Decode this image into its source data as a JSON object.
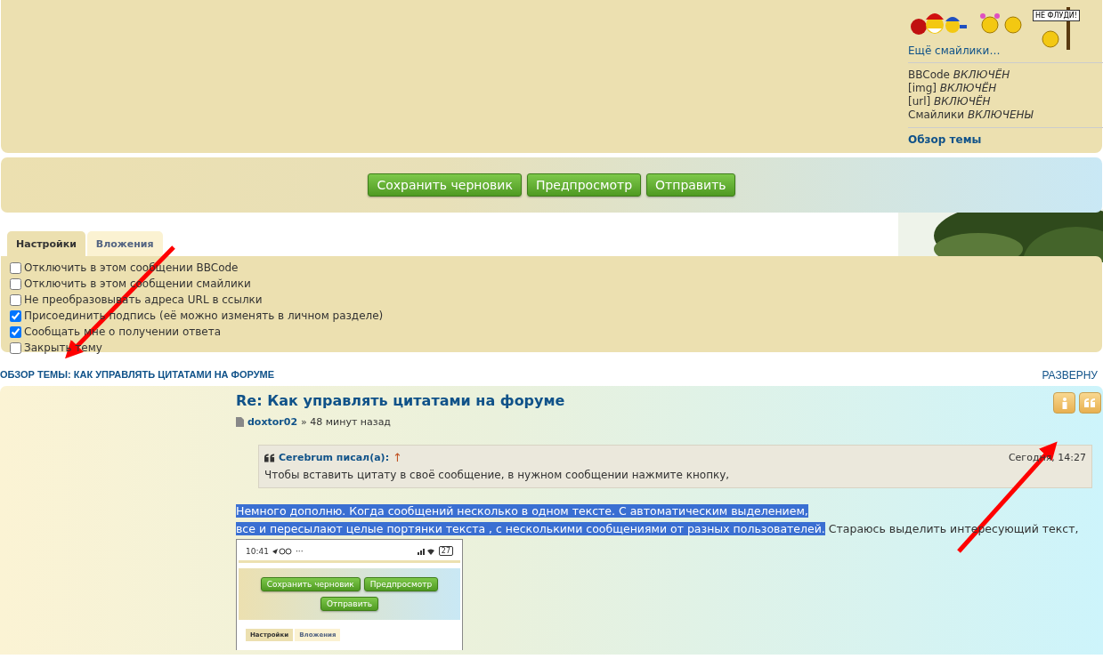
{
  "sidebar": {
    "smileys_sign": "НЕ ФЛУДИ!",
    "more_smileys": "Ещё смайлики…",
    "statuses": [
      "BBCode *ВКЛЮЧЁН*",
      "[img] *ВКЛЮЧЁН*",
      "[url] *ВКЛЮЧЁН*",
      "Смайлики *ВКЛЮЧЕНЫ*"
    ],
    "topic_review_link": "Обзор темы"
  },
  "submit_buttons": [
    "Сохранить черновик",
    "Предпросмотр",
    "Отправить"
  ],
  "tabs": [
    {
      "label": "Настройки",
      "selected": true
    },
    {
      "label": "Вложения",
      "selected": false
    }
  ],
  "options": [
    {
      "label": "Отключить в этом сообщении BBCode",
      "checked": false
    },
    {
      "label": "Отключить в этом сообщении смайлики",
      "checked": false
    },
    {
      "label": "Не преобразовывать адреса URL в ссылки",
      "checked": false
    },
    {
      "label": "Присоединить подпись (её можно изменять в личном разделе)",
      "checked": true
    },
    {
      "label": "Сообщать мне о получении ответа",
      "checked": true
    },
    {
      "label": "Закрыть тему",
      "checked": false
    }
  ],
  "review": {
    "title": "ОБЗОР ТЕМЫ: КАК УПРАВЛЯТЬ ЦИТАТАМИ НА ФОРУМЕ",
    "expand": "РАЗВЕРНУ"
  },
  "post": {
    "title": "Re: Как управлять цитатами на форуме",
    "author": "doxtor02",
    "separator": "»",
    "time": "48 минут назад",
    "quote": {
      "author": "Cerebrum писал(а):",
      "arrow": "↑",
      "date": "Сегодня, 14:27",
      "text": "Чтобы вставить цитату в своё сообщение, в нужном сообщении нажмите кнопку,"
    },
    "selected_lines": [
      "Немного дополню. Когда сообщений несколько в одном тексте. С автоматическим выделением,",
      "все и пересылают целые портянки текста , с несколькими сообщениями от разных пользователей."
    ],
    "after_selection": "Стараюсь выделить интересующий текст,",
    "screenshot": {
      "time": "10:41",
      "more": "···",
      "battery": "27",
      "buttons": [
        "Сохранить черновик",
        "Предпросмотр",
        "Отправить"
      ],
      "tabs": [
        {
          "label": "Настройки",
          "selected": true
        },
        {
          "label": "Вложения",
          "selected": false
        }
      ]
    }
  }
}
